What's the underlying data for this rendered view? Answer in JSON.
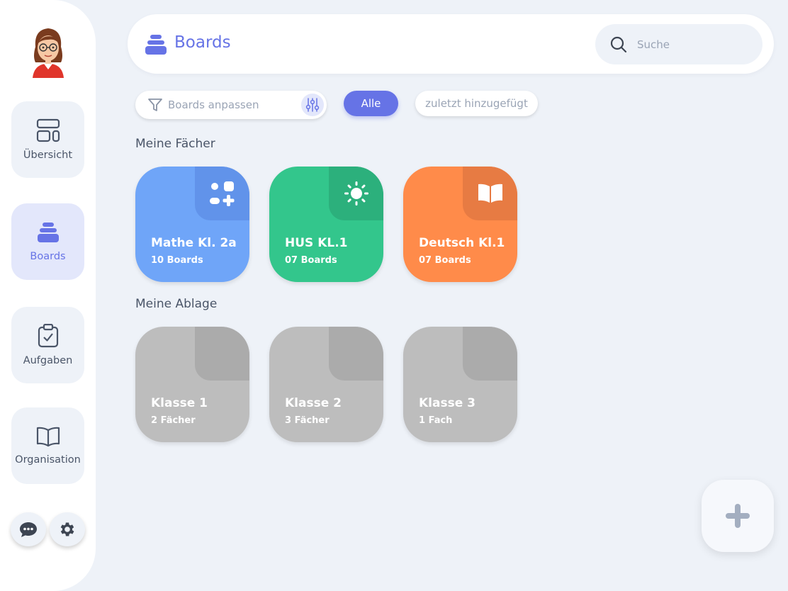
{
  "colors": {
    "accent": "#6673e6",
    "mathe": "#6fa5f8",
    "hus": "#33c68c",
    "deutsch": "#ff8b4a",
    "archive": "#bdbdbd"
  },
  "sidebar": {
    "items": [
      {
        "label": "Übersicht",
        "icon": "layout-icon"
      },
      {
        "label": "Boards",
        "icon": "boards-stack-icon"
      },
      {
        "label": "Aufgaben",
        "icon": "clipboard-check-icon"
      },
      {
        "label": "Organisation",
        "icon": "open-book-icon"
      }
    ],
    "chat_icon": "chat-bubble-icon",
    "settings_icon": "gear-icon"
  },
  "header": {
    "title": "Boards",
    "search_placeholder": "Suche"
  },
  "toolbar": {
    "filter_placeholder": "Boards anpassen",
    "chip_all": "Alle",
    "chip_recent": "zuletzt hinzugefügt"
  },
  "sections": {
    "subjects_title": "Meine Fächer",
    "archive_title": "Meine Ablage"
  },
  "subjects": [
    {
      "title": "Mathe Kl. 2a",
      "subtitle": "10 Boards",
      "icon": "math-shapes-icon"
    },
    {
      "title": "HUS KL.1",
      "subtitle": "07 Boards",
      "icon": "sun-icon"
    },
    {
      "title": "Deutsch Kl.1",
      "subtitle": "07 Boards",
      "icon": "book-icon"
    }
  ],
  "archive": [
    {
      "title": "Klasse 1",
      "subtitle": "2 Fächer"
    },
    {
      "title": "Klasse 2",
      "subtitle": "3 Fächer"
    },
    {
      "title": "Klasse 3",
      "subtitle": "1 Fach"
    }
  ],
  "fab_icon": "plus-icon"
}
